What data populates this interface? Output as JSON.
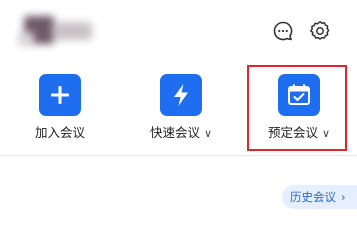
{
  "header": {
    "chat_icon": "chat-bubble-icon",
    "settings_icon": "gear-icon"
  },
  "actions": [
    {
      "label": "加入会议",
      "icon": "plus-icon",
      "has_dropdown": false
    },
    {
      "label": "快速会议",
      "icon": "lightning-icon",
      "has_dropdown": true,
      "dropdown_glyph": "∨"
    },
    {
      "label": "预定会议",
      "icon": "calendar-icon",
      "has_dropdown": true,
      "dropdown_glyph": "∨"
    }
  ],
  "history": {
    "label": "历史会议",
    "chevron": "›"
  },
  "colors": {
    "accent": "#1f6ef0",
    "highlight_border": "#e2262a",
    "history_bg": "#e6efff",
    "history_text": "#2a66d8"
  }
}
